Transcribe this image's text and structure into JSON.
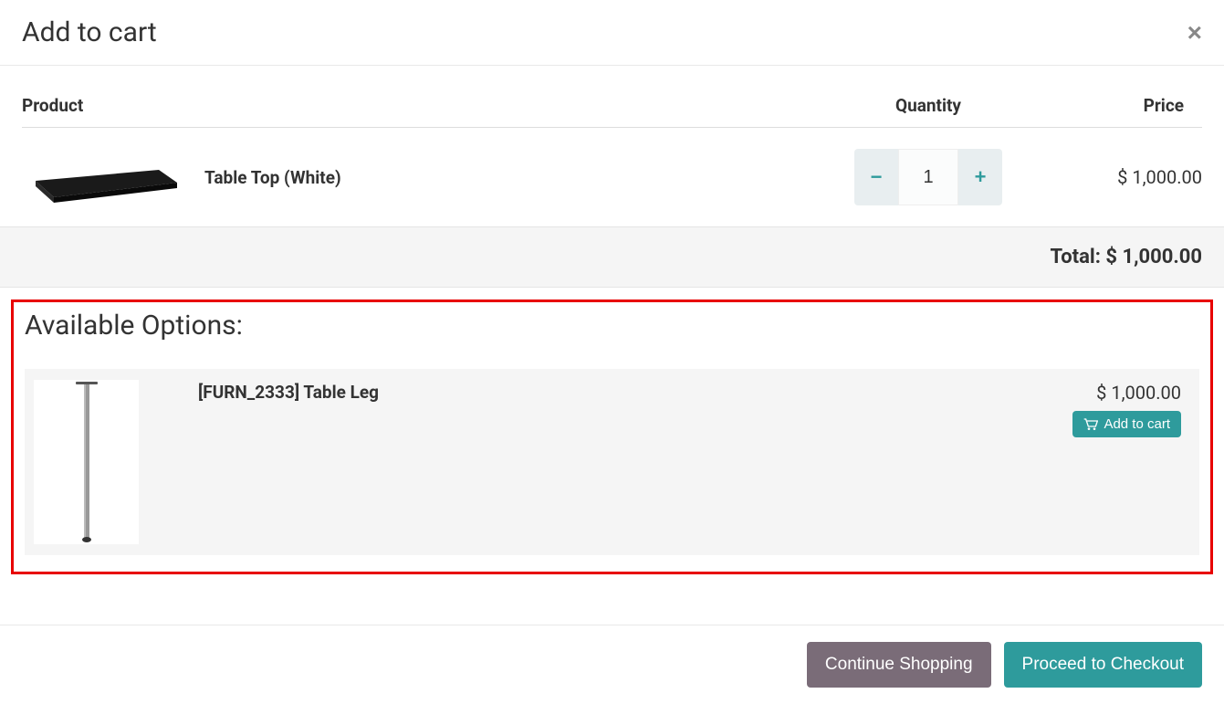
{
  "modal": {
    "title": "Add to cart"
  },
  "table": {
    "headers": {
      "product": "Product",
      "quantity": "Quantity",
      "price": "Price"
    }
  },
  "cart_item": {
    "name": "Table Top (White)",
    "quantity": "1",
    "price": "$ 1,000.00"
  },
  "total": {
    "label": "Total: ",
    "amount": "$ 1,000.00"
  },
  "options": {
    "title": "Available Options:",
    "item": {
      "name": "[FURN_2333] Table Leg",
      "price": "$ 1,000.00",
      "button_label": "Add to cart"
    }
  },
  "footer": {
    "continue": "Continue Shopping",
    "checkout": "Proceed to Checkout"
  }
}
